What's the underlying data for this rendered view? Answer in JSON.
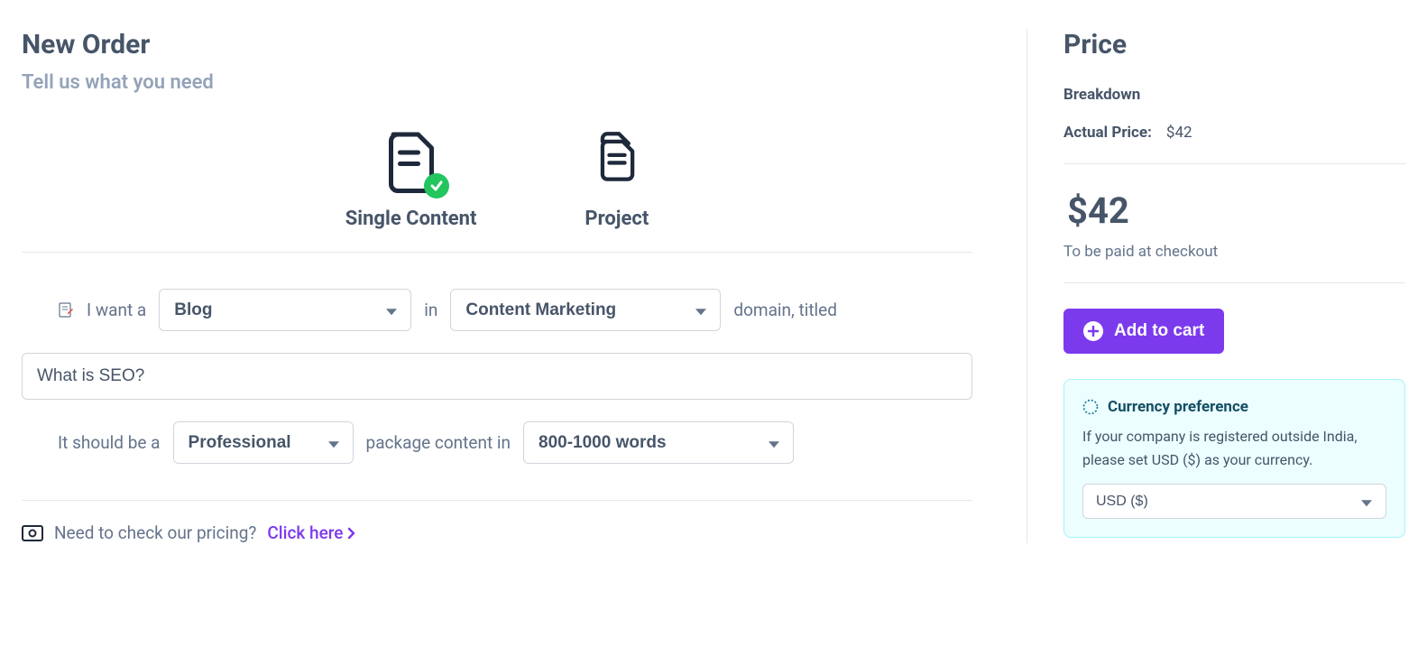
{
  "page": {
    "title": "New Order",
    "subtitle": "Tell us what you need"
  },
  "tabs": {
    "single": "Single Content",
    "project": "Project"
  },
  "form": {
    "iwant": "I want a",
    "blog": "Blog",
    "in": "in",
    "domain": "Content Marketing",
    "domain_titled": "domain, titled",
    "title_value": "What is SEO?",
    "should_be": "It should be a",
    "professional": "Professional",
    "package_in": "package content in",
    "words": "800-1000 words"
  },
  "pricing_row": {
    "text": "Need to check our pricing?",
    "link": "Click here"
  },
  "price": {
    "heading": "Price",
    "breakdown": "Breakdown",
    "actual_label": "Actual Price:",
    "actual_value": "$42",
    "total": "$42",
    "note": "To be paid at checkout",
    "add_cart": "Add to cart"
  },
  "currency": {
    "title": "Currency preference",
    "text": "If your company is registered outside India, please set USD ($) as your currency.",
    "selected": "USD ($)"
  }
}
